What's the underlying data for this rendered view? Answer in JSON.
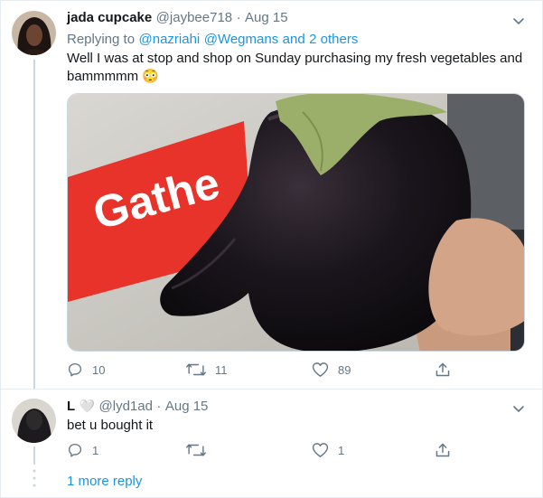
{
  "tweet": {
    "author_name": "jada cupcake",
    "handle": "@jaybee718",
    "separator": "·",
    "date": "Aug 15",
    "replying_label": "Replying to",
    "replying_to": [
      "@nazriahi",
      "@Wegmans"
    ],
    "replying_and": "and",
    "replying_others": "2 others",
    "text": "Well I was at stop and shop on Sunday purchasing my fresh vegetables and bammmmm 😳",
    "media_sign_text": "Gathe",
    "reply_count": "10",
    "retweet_count": "11",
    "like_count": "89"
  },
  "reply": {
    "author_name": "L",
    "author_emoji": "🤍",
    "handle": "@lyd1ad",
    "separator": "·",
    "date": "Aug 15",
    "text": "bet u bought it",
    "reply_count": "1",
    "retweet_count": "",
    "like_count": "1"
  },
  "more_replies_label": "1 more reply",
  "colors": {
    "accent": "#1b95e0",
    "muted": "#657786",
    "border": "#e6ecf0",
    "sign_red": "#e8332a"
  },
  "icons": {
    "caret": "chevron-down-icon",
    "reply": "reply-icon",
    "retweet": "retweet-icon",
    "like": "heart-icon",
    "share": "share-icon"
  }
}
